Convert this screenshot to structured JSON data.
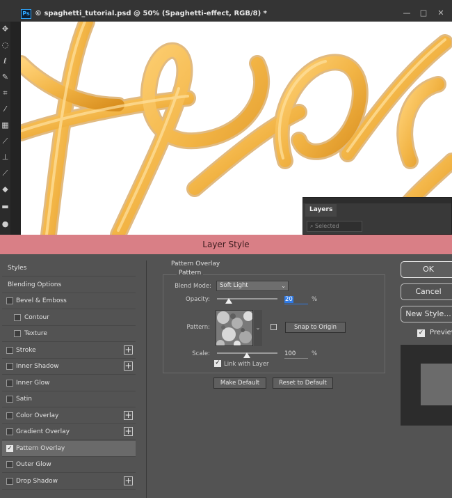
{
  "window": {
    "app_logo": "Ps",
    "doc_title": "© spaghetti_tutorial.psd @ 50% (Spaghetti-effect, RGB/8) *",
    "minimize": "—",
    "restore": "□",
    "close": "✕"
  },
  "layers_panel": {
    "tab": "Layers",
    "filter_placeholder": "Selected"
  },
  "dialog": {
    "title": "Layer Style",
    "styles": [
      {
        "label": "Styles",
        "checkbox": false,
        "checked": false,
        "plus": false,
        "indent": false
      },
      {
        "label": "Blending Options",
        "checkbox": false,
        "checked": false,
        "plus": false,
        "indent": false
      },
      {
        "label": "Bevel & Emboss",
        "checkbox": true,
        "checked": false,
        "plus": false,
        "indent": false
      },
      {
        "label": "Contour",
        "checkbox": true,
        "checked": false,
        "plus": false,
        "indent": true
      },
      {
        "label": "Texture",
        "checkbox": true,
        "checked": false,
        "plus": false,
        "indent": true
      },
      {
        "label": "Stroke",
        "checkbox": true,
        "checked": false,
        "plus": true,
        "indent": false
      },
      {
        "label": "Inner Shadow",
        "checkbox": true,
        "checked": false,
        "plus": true,
        "indent": false
      },
      {
        "label": "Inner Glow",
        "checkbox": true,
        "checked": false,
        "plus": false,
        "indent": false
      },
      {
        "label": "Satin",
        "checkbox": true,
        "checked": false,
        "plus": false,
        "indent": false
      },
      {
        "label": "Color Overlay",
        "checkbox": true,
        "checked": false,
        "plus": true,
        "indent": false
      },
      {
        "label": "Gradient Overlay",
        "checkbox": true,
        "checked": false,
        "plus": true,
        "indent": false
      },
      {
        "label": "Pattern Overlay",
        "checkbox": true,
        "checked": true,
        "plus": false,
        "indent": false
      },
      {
        "label": "Outer Glow",
        "checkbox": true,
        "checked": false,
        "plus": false,
        "indent": false
      },
      {
        "label": "Drop Shadow",
        "checkbox": true,
        "checked": false,
        "plus": true,
        "indent": false
      }
    ],
    "panel_title": "Pattern Overlay",
    "group_title": "Pattern",
    "blend_mode_label": "Blend Mode:",
    "blend_mode_value": "Soft Light",
    "opacity_label": "Opacity:",
    "opacity_value": "20",
    "opacity_unit": "%",
    "pattern_label": "Pattern:",
    "snap_button": "Snap to Origin",
    "scale_label": "Scale:",
    "scale_value": "100",
    "scale_unit": "%",
    "link_label": "Link with Layer",
    "make_default": "Make Default",
    "reset_default": "Reset to Default",
    "ok": "OK",
    "cancel": "Cancel",
    "new_style": "New Style...",
    "preview_label": "Preview"
  },
  "colors": {
    "title_bar": "#d97f86",
    "dialog_bg": "#535353",
    "spaghetti": "#f2b445"
  },
  "icons": [
    "move-tool-icon",
    "marquee-tool-icon",
    "lasso-tool-icon",
    "quick-select-icon",
    "crop-tool-icon",
    "eyedropper-icon",
    "healing-brush-icon",
    "brush-tool-icon",
    "stamp-tool-icon",
    "history-brush-icon",
    "eraser-icon",
    "gradient-tool-icon",
    "blur-tool-icon"
  ]
}
